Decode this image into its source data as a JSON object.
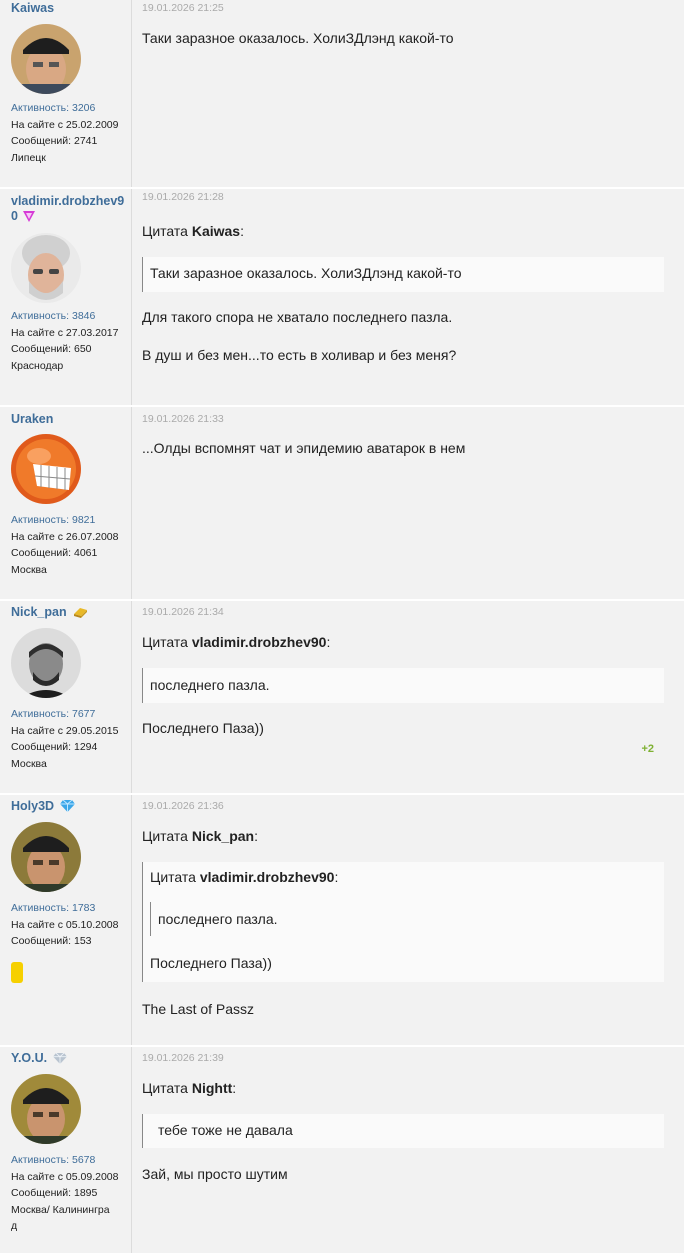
{
  "labels": {
    "activity": "Активность: ",
    "since": "На сайте с ",
    "messages": "Сообщений: ",
    "quote": "Цитата "
  },
  "posts": [
    {
      "username": "Kaiwas",
      "activity": "3206",
      "since": "25.02.2009",
      "messages": "2741",
      "location": "Липецк",
      "date": "19.01.2026 21:25",
      "text": "Таки заразное оказалось. ХолиЗДлэнд какой-то"
    },
    {
      "username_line1": "vladimir.drobzhev9",
      "username_line2": "0",
      "activity": "3846",
      "since": "27.03.2017",
      "messages": "650",
      "location": "Краснодар",
      "date": "19.01.2026 21:28",
      "quote_author": "Kaiwas",
      "quote_text": "Таки заразное оказалось. ХолиЗДлэнд какой-то",
      "text1": "Для такого спора не хватало последнего пазла.",
      "text2": "В душ и без мен...то есть в холивар и без меня?"
    },
    {
      "username": "Uraken",
      "activity": "9821",
      "since": "26.07.2008",
      "messages": "4061",
      "location": "Москва",
      "date": "19.01.2026 21:33",
      "text": "...Олды вспомнят чат и эпидемию аватарок в нем"
    },
    {
      "username": "Nick_pan",
      "activity": "7677",
      "since": "29.05.2015",
      "messages": "1294",
      "location": "Москва",
      "date": "19.01.2026 21:34",
      "quote_author": "vladimir.drobzhev90",
      "quote_text": "последнего пазла.",
      "text": "Последнего Паза))",
      "rating": "+2"
    },
    {
      "username": "Holy3D",
      "activity": "1783",
      "since": "05.10.2008",
      "messages": "153",
      "date": "19.01.2026 21:36",
      "quote_author": "Nick_pan",
      "inner_quote_author": "vladimir.drobzhev90",
      "inner_quote_text": "последнего пазла.",
      "quote_text": "Последнего Паза))",
      "text": "The Last of Passz"
    },
    {
      "username": "Y.O.U.",
      "activity": "5678",
      "since": "05.09.2008",
      "messages": "1895",
      "location_line1": "Москва/ Калинингра",
      "location_line2": "д",
      "date": "19.01.2026 21:39",
      "quote_author": "Nightt",
      "quote_text": "тебе тоже не давала",
      "text": "Зай, мы просто шутим"
    }
  ],
  "colors": {
    "username": "#3f6d99",
    "rating": "#7fb133",
    "background": "#f2f2f2"
  }
}
